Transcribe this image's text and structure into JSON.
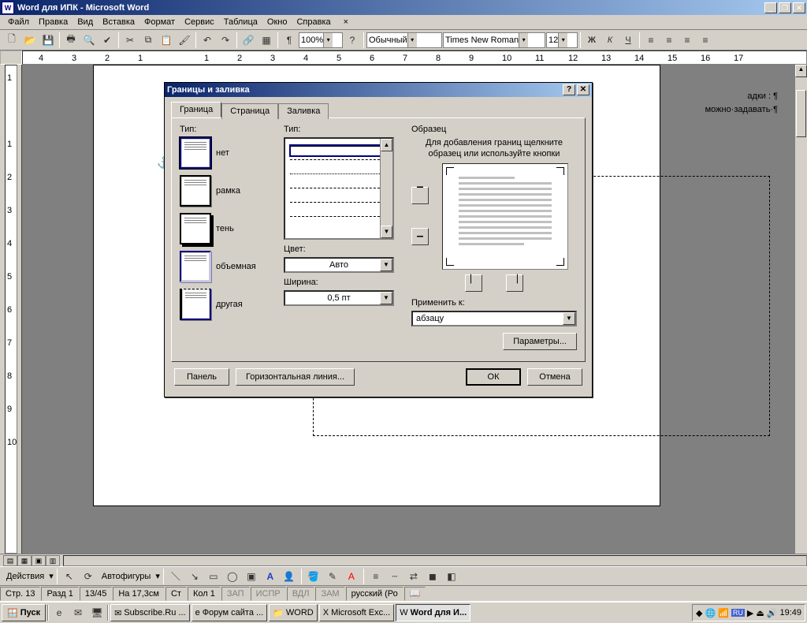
{
  "window": {
    "title": "Word для  ИПК - Microsoft Word"
  },
  "menu": {
    "items": [
      "Файл",
      "Правка",
      "Вид",
      "Вставка",
      "Формат",
      "Сервис",
      "Таблица",
      "Окно",
      "Справка"
    ]
  },
  "toolbar": {
    "zoom": "100%",
    "style": "Обычный",
    "font": "Times New Roman",
    "size": "12"
  },
  "ruler_marks": [
    "4",
    "3",
    "2",
    "1",
    "",
    "1",
    "2",
    "3",
    "4",
    "5",
    "6",
    "7",
    "8",
    "9",
    "10",
    "11",
    "12",
    "13",
    "14",
    "15",
    "16",
    "17"
  ],
  "vruler": [
    "1",
    "",
    "1",
    "2",
    "3",
    "4",
    "5",
    "6",
    "7",
    "8",
    "9",
    "10"
  ],
  "doc": {
    "line1": "адки : ¶",
    "line2": "можно·задавать·¶"
  },
  "dialog": {
    "title": "Границы и заливка",
    "tabs": [
      "Граница",
      "Страница",
      "Заливка"
    ],
    "col1": {
      "label": "Тип:",
      "opts": [
        "нет",
        "рамка",
        "тень",
        "объемная",
        "другая"
      ]
    },
    "col2": {
      "type_label": "Тип:",
      "color_label": "Цвет:",
      "color_value": "Авто",
      "width_label": "Ширина:",
      "width_value": "0,5 пт"
    },
    "col3": {
      "label": "Образец",
      "hint": "Для добавления границ щелкните образец или используйте кнопки",
      "apply_label": "Применить к:",
      "apply_value": "абзацу",
      "params": "Параметры..."
    },
    "buttons": {
      "panel": "Панель",
      "hline": "Горизонтальная линия...",
      "ok": "ОК",
      "cancel": "Отмена"
    }
  },
  "drawbar": {
    "actions": "Действия",
    "autoshapes": "Автофигуры"
  },
  "status": {
    "page": "Стр. 13",
    "section": "Разд 1",
    "pages": "13/45",
    "at": "На  17,3см",
    "line": "Ст",
    "col": "Кол  1",
    "rec": "ЗАП",
    "trk": "ИСПР",
    "ext": "ВДЛ",
    "ovr": "ЗАМ",
    "lang": "русский (Ро"
  },
  "taskbar": {
    "start": "Пуск",
    "items": [
      "Subscribe.Ru ...",
      "Форум сайта ...",
      "WORD",
      "Microsoft Exc...",
      "Word для  И..."
    ],
    "clock": "19:49"
  }
}
